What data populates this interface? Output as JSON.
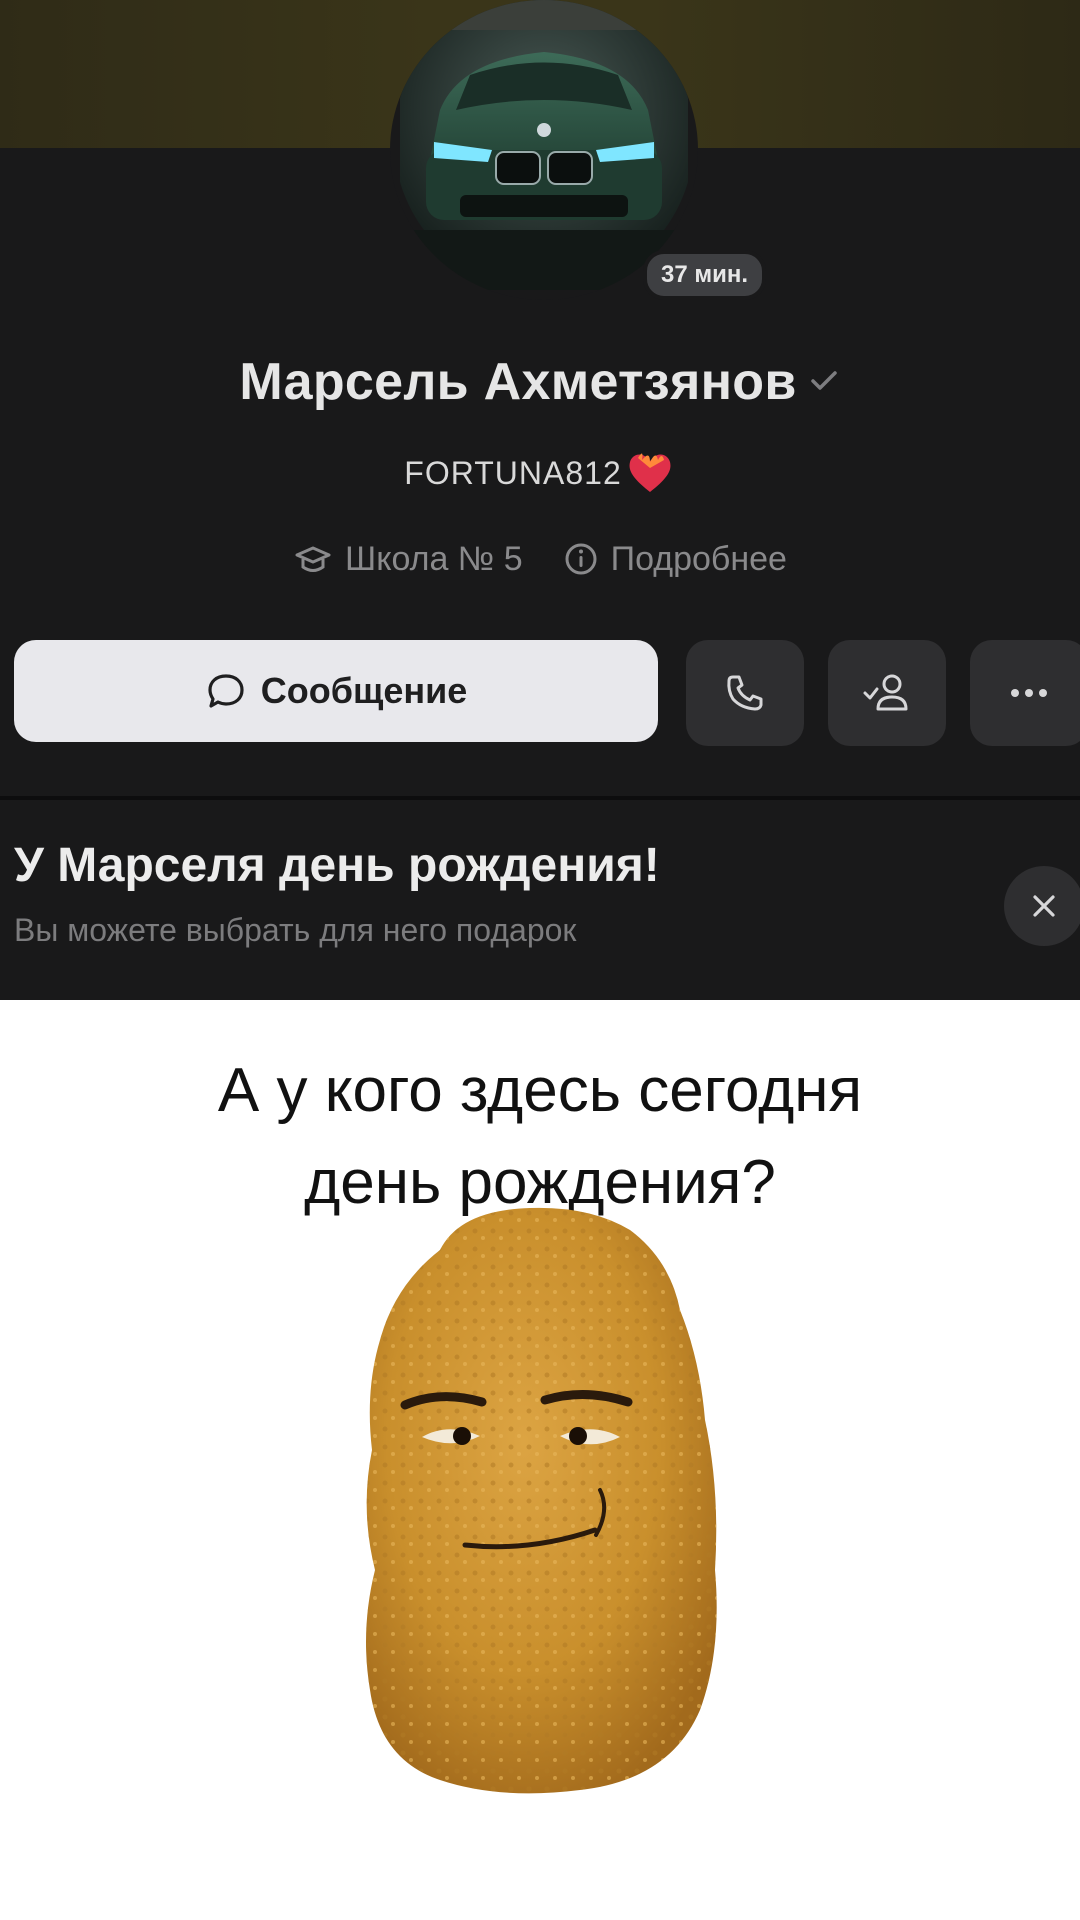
{
  "profile": {
    "name": "Марсель Ахметзянов",
    "status": "FORTUNA812",
    "last_seen": "37 мин.",
    "school": "Школа № 5",
    "more": "Подробнее",
    "message_button": "Сообщение"
  },
  "birthday_banner": {
    "title": "У Марселя день рождения!",
    "subtitle": "Вы можете выбрать для него подарок"
  },
  "meme": {
    "line1": "А у кого здесь сегодня",
    "line2": "день рождения?"
  },
  "colors": {
    "background_dark": "#19191a",
    "button_light": "#e8e8ec",
    "button_dark": "#2e2e30",
    "cover": "#3a3519",
    "car_green": "#254a3a",
    "headlight": "#7fe6ff",
    "nugget": "#c98f2c"
  },
  "icons": [
    "verified-check-icon",
    "heart-fire-icon",
    "graduation-cap-icon",
    "info-icon",
    "message-bubble-icon",
    "phone-icon",
    "friend-added-icon",
    "more-dots-icon",
    "close-icon"
  ]
}
